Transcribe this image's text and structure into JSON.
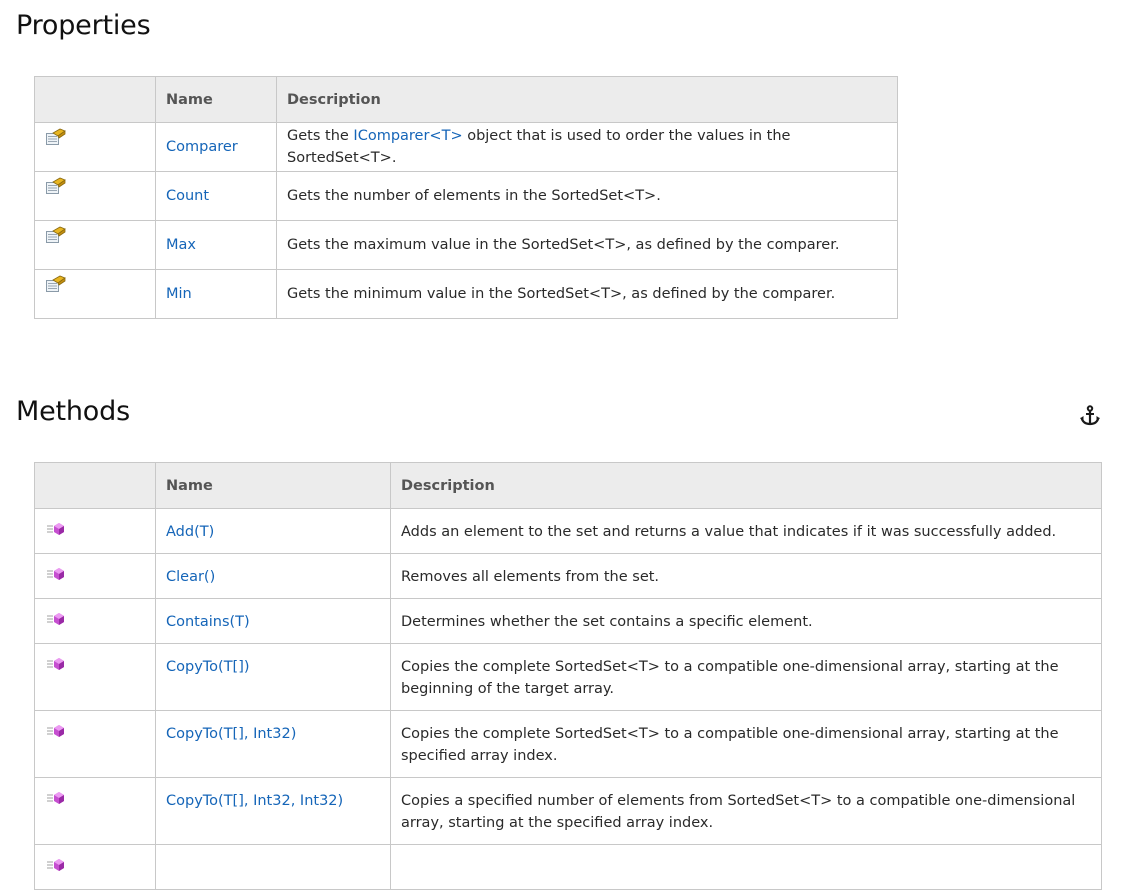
{
  "properties": {
    "title": "Properties",
    "headers": {
      "icon": "",
      "name": "Name",
      "description": "Description"
    },
    "rows": [
      {
        "icon": "property-icon",
        "name": "Comparer",
        "desc_before": "Gets the ",
        "desc_link": "IComparer<T>",
        "desc_after": " object that is used to order the values in the SortedSet<T>."
      },
      {
        "icon": "property-icon",
        "name": "Count",
        "desc_before": "Gets the number of elements in the SortedSet<T>.",
        "desc_link": "",
        "desc_after": ""
      },
      {
        "icon": "property-icon",
        "name": "Max",
        "desc_before": "Gets the maximum value in the SortedSet<T>, as defined by the comparer.",
        "desc_link": "",
        "desc_after": ""
      },
      {
        "icon": "property-icon",
        "name": "Min",
        "desc_before": "Gets the minimum value in the SortedSet<T>, as defined by the comparer.",
        "desc_link": "",
        "desc_after": ""
      }
    ]
  },
  "methods": {
    "title": "Methods",
    "anchor_icon": "anchor-icon",
    "headers": {
      "icon": "",
      "name": "Name",
      "description": "Description"
    },
    "rows": [
      {
        "icon": "method-icon",
        "name": "Add(T)",
        "description": "Adds an element to the set and returns a value that indicates if it was successfully added."
      },
      {
        "icon": "method-icon",
        "name": "Clear()",
        "description": "Removes all elements from the set."
      },
      {
        "icon": "method-icon",
        "name": "Contains(T)",
        "description": "Determines whether the set contains a specific element."
      },
      {
        "icon": "method-icon",
        "name": "CopyTo(T[])",
        "description": "Copies the complete SortedSet<T> to a compatible one-dimensional array, starting at the beginning of the target array."
      },
      {
        "icon": "method-icon",
        "name": "CopyTo(T[],  Int32)",
        "description": "Copies the complete SortedSet<T> to a compatible one-dimensional array, starting at the specified array index."
      },
      {
        "icon": "method-icon",
        "name": "CopyTo(T[],  Int32,  Int32)",
        "description": "Copies a specified number of elements from SortedSet<T> to a compatible one-dimensional array, starting at the specified array index."
      },
      {
        "icon": "method-icon",
        "name": "",
        "description": ""
      }
    ]
  }
}
